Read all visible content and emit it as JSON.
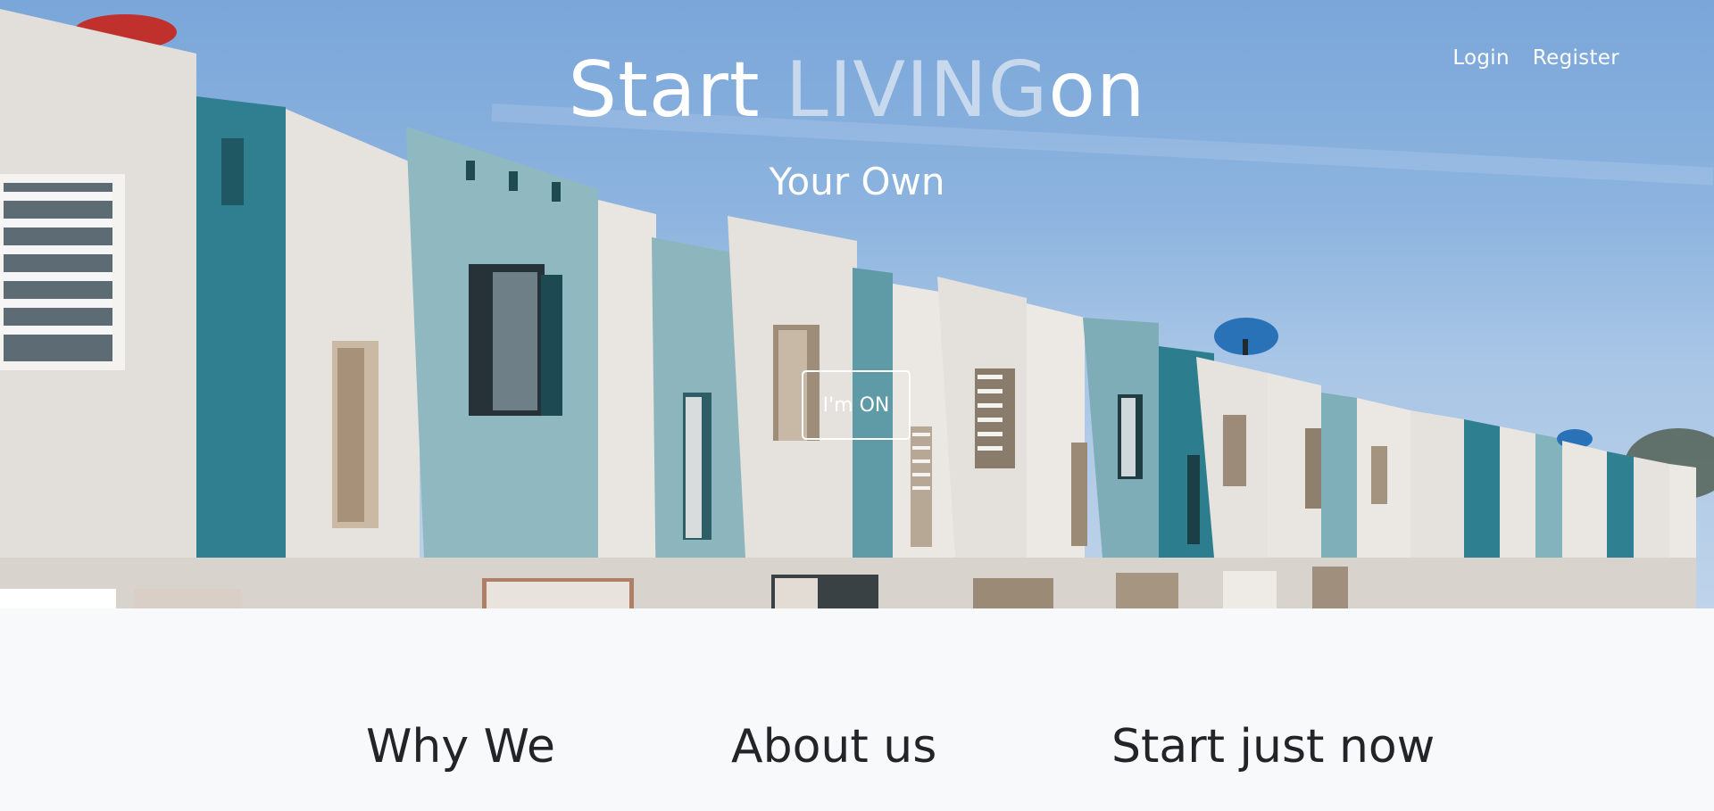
{
  "nav": {
    "login": "Login",
    "register": "Register"
  },
  "hero": {
    "title_start": "Start ",
    "title_accent": "LIVING",
    "title_end": "on",
    "subtitle": "Your Own",
    "cta_label": "I'm ON"
  },
  "features": {
    "col1": "Why We",
    "col2": "About us",
    "col3": "Start just now"
  },
  "colors": {
    "sky": "#7aa6d9",
    "teal": "#2f7f90",
    "light_blue_wall": "#8fb8c0",
    "white_wall": "#e8e4df",
    "headline_accent": "#c8d9ee",
    "section_bg": "#f8f9fb",
    "heading_text": "#222428"
  }
}
